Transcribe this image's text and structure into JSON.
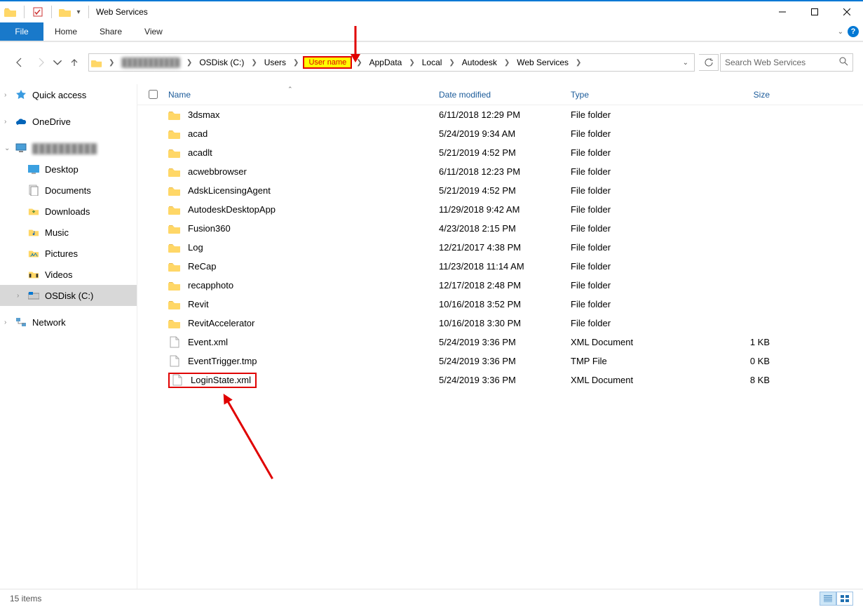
{
  "window": {
    "title": "Web Services"
  },
  "tabs": {
    "file": "File",
    "home": "Home",
    "share": "Share",
    "view": "View"
  },
  "breadcrumb": {
    "items": [
      "OSDisk (C:)",
      "Users",
      "User name",
      "AppData",
      "Local",
      "Autodesk",
      "Web Services"
    ],
    "highlight_index": 2
  },
  "search": {
    "placeholder": "Search Web Services"
  },
  "sidebar": {
    "quick_access": "Quick access",
    "onedrive": "OneDrive",
    "this_pc": "██████████",
    "desktop": "Desktop",
    "documents": "Documents",
    "downloads": "Downloads",
    "music": "Music",
    "pictures": "Pictures",
    "videos": "Videos",
    "osdisk": "OSDisk (C:)",
    "network": "Network"
  },
  "columns": {
    "name": "Name",
    "date": "Date modified",
    "type": "Type",
    "size": "Size"
  },
  "files": [
    {
      "name": "3dsmax",
      "date": "6/11/2018 12:29 PM",
      "type": "File folder",
      "size": "",
      "kind": "folder"
    },
    {
      "name": "acad",
      "date": "5/24/2019 9:34 AM",
      "type": "File folder",
      "size": "",
      "kind": "folder"
    },
    {
      "name": "acadlt",
      "date": "5/21/2019 4:52 PM",
      "type": "File folder",
      "size": "",
      "kind": "folder"
    },
    {
      "name": "acwebbrowser",
      "date": "6/11/2018 12:23 PM",
      "type": "File folder",
      "size": "",
      "kind": "folder"
    },
    {
      "name": "AdskLicensingAgent",
      "date": "5/21/2019 4:52 PM",
      "type": "File folder",
      "size": "",
      "kind": "folder"
    },
    {
      "name": "AutodeskDesktopApp",
      "date": "11/29/2018 9:42 AM",
      "type": "File folder",
      "size": "",
      "kind": "folder"
    },
    {
      "name": "Fusion360",
      "date": "4/23/2018 2:15 PM",
      "type": "File folder",
      "size": "",
      "kind": "folder"
    },
    {
      "name": "Log",
      "date": "12/21/2017 4:38 PM",
      "type": "File folder",
      "size": "",
      "kind": "folder"
    },
    {
      "name": "ReCap",
      "date": "11/23/2018 11:14 AM",
      "type": "File folder",
      "size": "",
      "kind": "folder"
    },
    {
      "name": "recapphoto",
      "date": "12/17/2018 2:48 PM",
      "type": "File folder",
      "size": "",
      "kind": "folder"
    },
    {
      "name": "Revit",
      "date": "10/16/2018 3:52 PM",
      "type": "File folder",
      "size": "",
      "kind": "folder"
    },
    {
      "name": "RevitAccelerator",
      "date": "10/16/2018 3:30 PM",
      "type": "File folder",
      "size": "",
      "kind": "folder"
    },
    {
      "name": "Event.xml",
      "date": "5/24/2019 3:36 PM",
      "type": "XML Document",
      "size": "1 KB",
      "kind": "file"
    },
    {
      "name": "EventTrigger.tmp",
      "date": "5/24/2019 3:36 PM",
      "type": "TMP File",
      "size": "0 KB",
      "kind": "file"
    },
    {
      "name": "LoginState.xml",
      "date": "5/24/2019 3:36 PM",
      "type": "XML Document",
      "size": "8 KB",
      "kind": "file",
      "highlight": true
    }
  ],
  "status": {
    "items_label": "15 items"
  }
}
